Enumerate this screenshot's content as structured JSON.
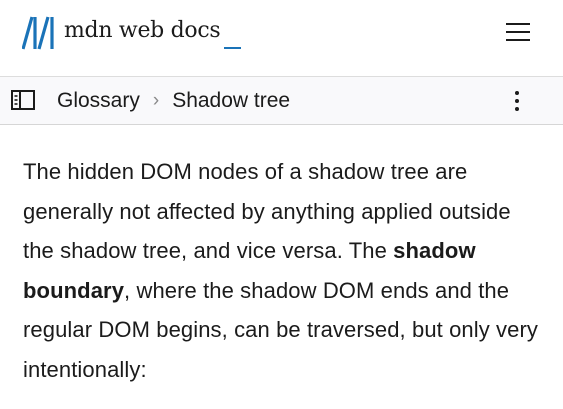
{
  "header": {
    "logo_text": "mdn web docs",
    "logo_icon": "mdn-logo-icon",
    "menu_icon": "hamburger-menu-icon",
    "accent_color": "#1a73b8"
  },
  "breadcrumb": {
    "sidebar_icon": "sidebar-toggle-icon",
    "items": [
      {
        "label": "Glossary"
      },
      {
        "label": "Shadow tree"
      }
    ],
    "separator": "›",
    "more_icon": "kebab-menu-icon"
  },
  "article": {
    "text_before": "The hidden DOM nodes of a shadow tree are generally not affected by anything applied outside the shadow tree, and vice versa. The ",
    "bold_term": "shadow boundary",
    "text_after": ", where the shadow DOM ends and the regular DOM begins, can be traversed, but only very intentionally:"
  }
}
